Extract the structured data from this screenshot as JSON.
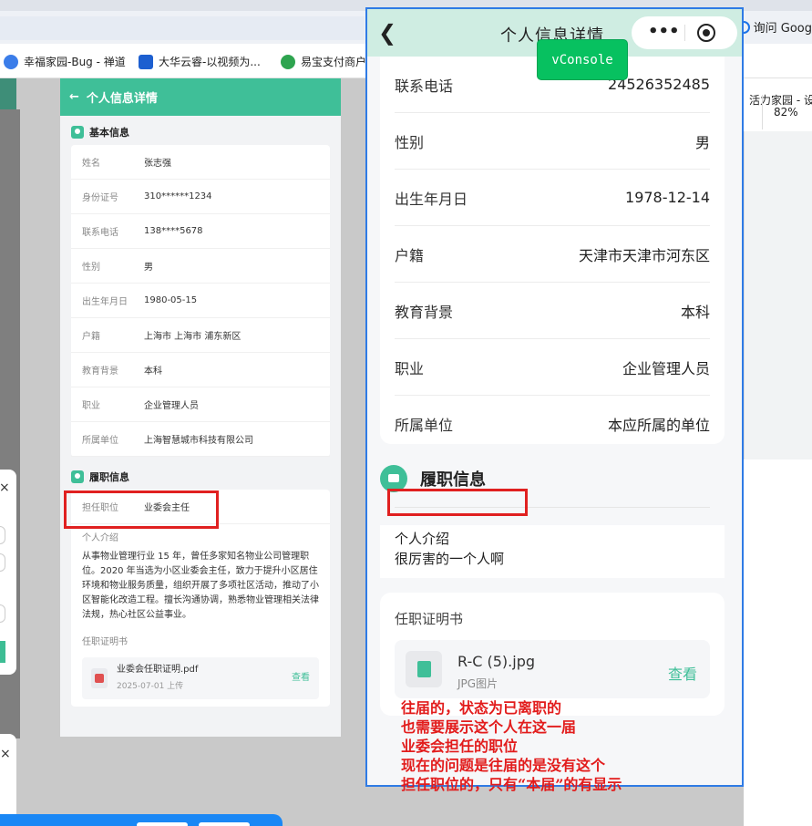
{
  "browser": {
    "bookmarks": [
      {
        "label": "幸福家园-Bug - 禅道",
        "color": "#3b7de9"
      },
      {
        "label": "大华云睿-以视频为...",
        "color": "#1d5fd0"
      },
      {
        "label": "易宝支付商户",
        "color": "#2ea44f"
      }
    ],
    "right_bookmark": "活力家园 - 设计",
    "ask_google": "询问 Goog",
    "zoom": "82%"
  },
  "mid": {
    "header_title": "个人信息详情",
    "basic_title": "基本信息",
    "basic_rows": [
      {
        "k": "姓名",
        "v": "张志强"
      },
      {
        "k": "身份证号",
        "v": "310******1234"
      },
      {
        "k": "联系电话",
        "v": "138****5678"
      },
      {
        "k": "性别",
        "v": "男"
      },
      {
        "k": "出生年月日",
        "v": "1980-05-15"
      },
      {
        "k": "户籍",
        "v": "上海市 上海市 浦东新区"
      },
      {
        "k": "教育背景",
        "v": "本科"
      },
      {
        "k": "职业",
        "v": "企业管理人员"
      },
      {
        "k": "所属单位",
        "v": "上海智慧城市科技有限公司"
      }
    ],
    "duty_title": "履职信息",
    "position_label": "担任职位",
    "position_value": "业委会主任",
    "intro_label": "个人介绍",
    "intro_text": "从事物业管理行业 15 年，曾任多家知名物业公司管理职位。2020 年当选为小区业委会主任，致力于提升小区居住环境和物业服务质量，组织开展了多项社区活动，推动了小区智能化改造工程。擅长沟通协调，熟悉物业管理相关法律法规，热心社区公益事业。",
    "cert_label": "任职证明书",
    "file_name": "业委会任职证明.pdf",
    "file_date": "2025-07-01 上传",
    "view_label": "查看"
  },
  "phone": {
    "title": "个人信息详情",
    "vconsole": "vConsole",
    "rows": [
      {
        "k": "联系电话",
        "v": "24526352485"
      },
      {
        "k": "性别",
        "v": "男"
      },
      {
        "k": "出生年月日",
        "v": "1978-12-14"
      },
      {
        "k": "户籍",
        "v": "天津市天津市河东区"
      },
      {
        "k": "教育背景",
        "v": "本科"
      },
      {
        "k": "职业",
        "v": "企业管理人员"
      },
      {
        "k": "所属单位",
        "v": "本应所属的单位"
      }
    ],
    "duty_title": "履职信息",
    "intro_label": "个人介绍",
    "intro_text": "很厉害的一个人啊",
    "cert_label": "任职证明书",
    "file_name": "R-C (5).jpg",
    "file_type": "JPG图片",
    "view_label": "查看"
  },
  "annotation": [
    "往届的，状态为已离职的",
    "也需要展示这个人在这一届",
    "业委会担任的职位",
    "现在的问题是往届的是没有这个",
    "担任职位的，只有“本届”的有显示"
  ]
}
